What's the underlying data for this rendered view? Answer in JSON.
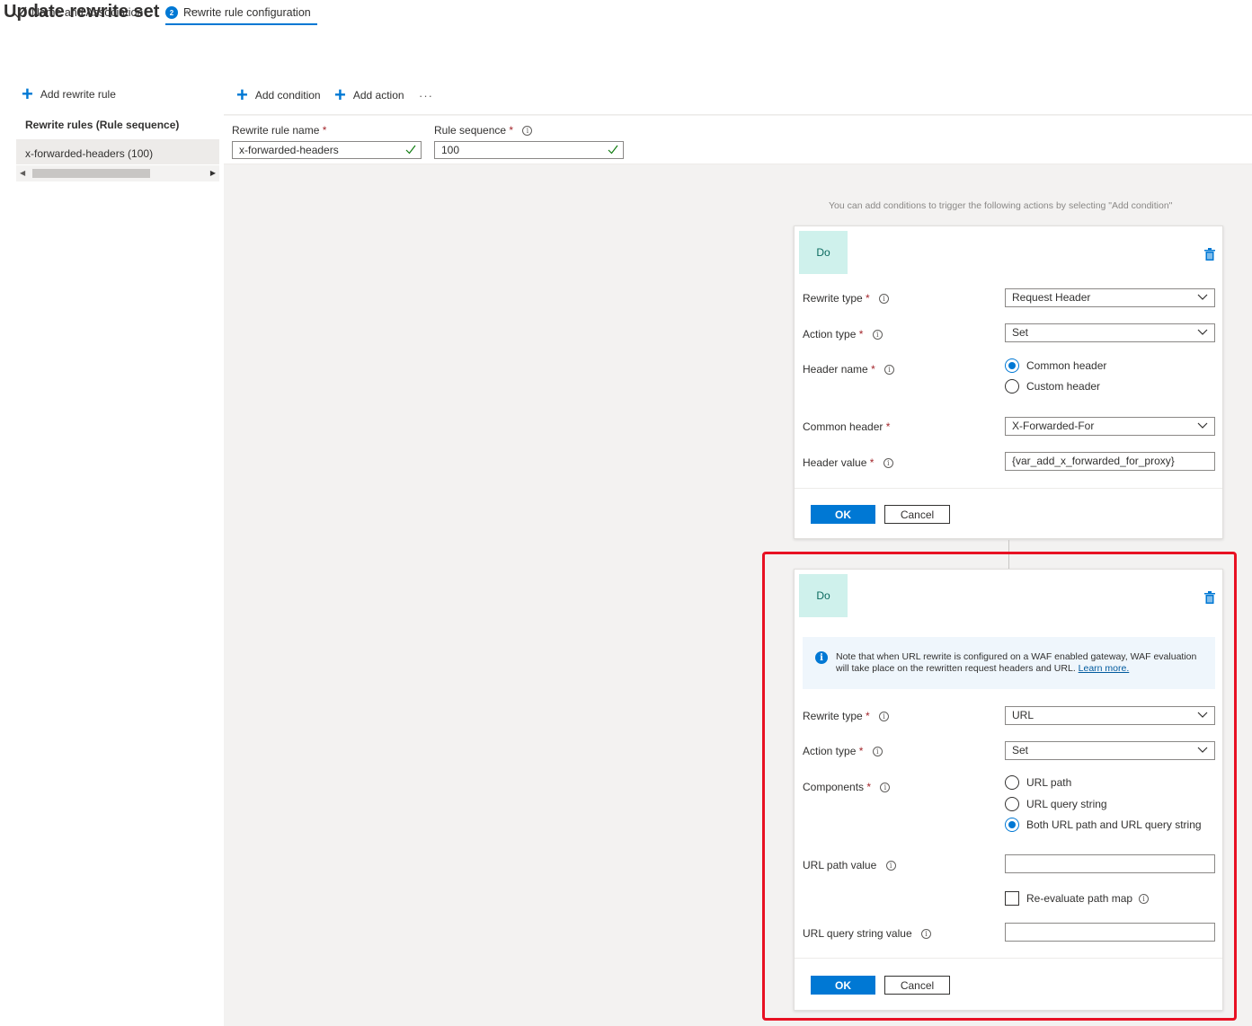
{
  "header": {
    "title": "Update rewrite set",
    "more": "···"
  },
  "steps": [
    {
      "label": "Name and Association",
      "state": "completed"
    },
    {
      "label": "Rewrite rule configuration",
      "number": "2",
      "state": "active"
    }
  ],
  "left_panel": {
    "add_rule_label": "Add rewrite rule",
    "rules_heading": "Rewrite rules (Rule sequence)",
    "rules": [
      "x-forwarded-headers (100)"
    ]
  },
  "toolbar": {
    "add_condition": "Add condition",
    "add_action": "Add action",
    "more": "···"
  },
  "rule_fields": {
    "name_label": "Rewrite rule name",
    "name_value": "x-forwarded-headers",
    "sequence_label": "Rule sequence",
    "sequence_value": "100",
    "required_mark": "*",
    "info_glyph": "i"
  },
  "hint": "You can add conditions to trigger the following actions by selecting \"Add condition\"",
  "action1": {
    "badge": "Do",
    "rewrite_type_label": "Rewrite type",
    "rewrite_type_value": "Request Header",
    "action_type_label": "Action type",
    "action_type_value": "Set",
    "header_name_label": "Header name",
    "header_name_options": [
      "Common header",
      "Custom header"
    ],
    "header_name_selected": "Common header",
    "common_header_label": "Common header",
    "common_header_value": "X-Forwarded-For",
    "header_value_label": "Header value",
    "header_value_value": "{var_add_x_forwarded_for_proxy}",
    "ok_label": "OK",
    "cancel_label": "Cancel"
  },
  "action2": {
    "badge": "Do",
    "info_text": "Note that when URL rewrite is configured on a WAF enabled gateway, WAF evaluation will take place on the rewritten request headers and URL.",
    "info_link": "Learn more.",
    "rewrite_type_label": "Rewrite type",
    "rewrite_type_value": "URL",
    "action_type_label": "Action type",
    "action_type_value": "Set",
    "components_label": "Components",
    "components_options": [
      "URL path",
      "URL query string",
      "Both URL path and URL query string"
    ],
    "components_selected": "Both URL path and URL query string",
    "url_path_label": "URL path value",
    "url_path_value": "",
    "reevaluate_label": "Re-evaluate path map",
    "reevaluate_checked": false,
    "query_string_label": "URL query string value",
    "query_string_value": "",
    "ok_label": "OK",
    "cancel_label": "Cancel"
  },
  "colors": {
    "accent": "#0078d4",
    "highlight_border": "#e81123",
    "do_badge_bg": "#cff1ec",
    "required": "#a4262c"
  },
  "icons": [
    "check-icon",
    "plus-icon",
    "info-icon",
    "chevron-down-icon",
    "trash-icon",
    "valid-check-icon"
  ]
}
